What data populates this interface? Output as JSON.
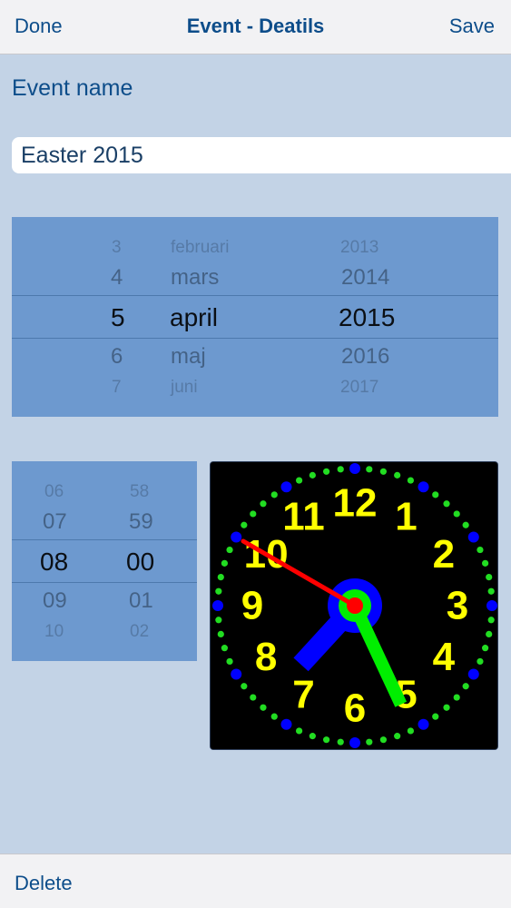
{
  "navbar": {
    "left_label": "Done",
    "title": "Event - Deatils",
    "right_label": "Save"
  },
  "form": {
    "event_name_label": "Event name",
    "event_name_value": "Easter 2015"
  },
  "date_picker": {
    "days": [
      "3",
      "4",
      "5",
      "6",
      "7"
    ],
    "months": [
      "februari",
      "mars",
      "april",
      "maj",
      "juni"
    ],
    "years": [
      "2013",
      "2014",
      "2015",
      "2016",
      "2017"
    ],
    "selected": {
      "day": "5",
      "month": "april",
      "year": "2015"
    }
  },
  "time_picker": {
    "hours": [
      "06",
      "07",
      "08",
      "09",
      "10"
    ],
    "minutes": [
      "58",
      "59",
      "00",
      "01",
      "02"
    ],
    "selected": {
      "hour": "08",
      "minute": "00"
    }
  },
  "clock": {
    "numerals": [
      "12",
      "1",
      "2",
      "3",
      "4",
      "5",
      "6",
      "7",
      "8",
      "9",
      "10",
      "11"
    ],
    "time": {
      "hour": 7,
      "minute": 25,
      "second": 50
    },
    "colors": {
      "face": "#000000",
      "numerals": "#ffff00",
      "hour_hand": "#0000ff",
      "minute_hand": "#00ee00",
      "second_hand": "#ff0000",
      "hour_dots": "#0000ff",
      "minute_dots": "#22dd22"
    }
  },
  "toolbar": {
    "delete_label": "Delete"
  }
}
